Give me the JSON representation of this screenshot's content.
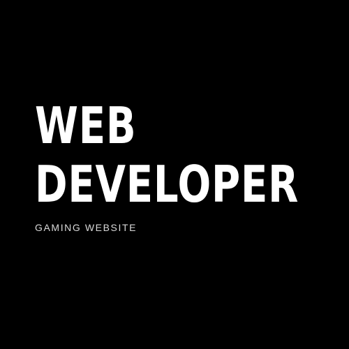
{
  "headline": {
    "line1": "WEB",
    "line2": "DEVELOPER"
  },
  "subtitle": "GAMING WEBSITE",
  "colors": {
    "background": "#000000",
    "headline": "#ffffff",
    "subtitle": "#d9d9d9"
  }
}
